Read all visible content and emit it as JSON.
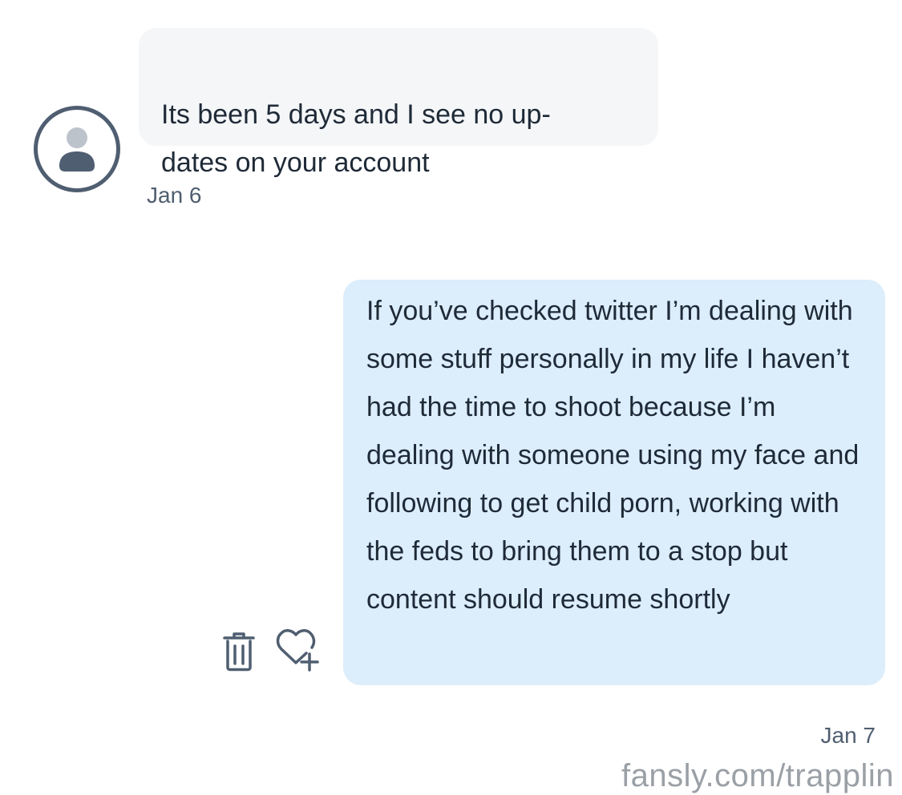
{
  "conversation": {
    "incoming": {
      "avatar_icon": "person-icon",
      "text": "Its been 5 days and I see no up-\ndates on your account",
      "date": "Jan 6"
    },
    "outgoing": {
      "text": "If you’ve checked twitter I’m dealing with some stuff personally in my life I haven’t had the time to shoot because I’m dealing with someone using my face and following to get child porn, working with the feds to bring them to a stop but content should resume shortly",
      "date": "Jan 7",
      "actions": {
        "delete_icon": "trash-icon",
        "like_icon": "heart-plus-icon"
      }
    }
  },
  "watermark": "fansly.com/trapplin",
  "colors": {
    "incoming_bubble": "#f4f6f8",
    "outgoing_bubble": "#dcedfb",
    "text": "#1f2a37",
    "muted": "#4f5e70",
    "watermark": "#9aa0a6"
  }
}
